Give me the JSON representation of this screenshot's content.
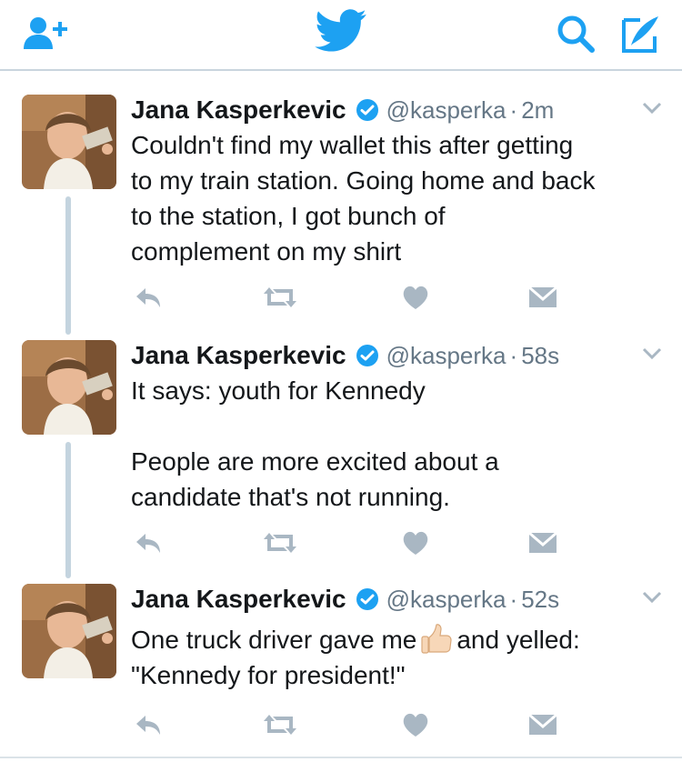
{
  "app": {
    "accent": "#1da1f2",
    "icon_gray": "#a9b7c3"
  },
  "topbar": {
    "icons": [
      "add-user-icon",
      "twitter-bird-icon",
      "search-icon",
      "compose-icon"
    ]
  },
  "tweets": [
    {
      "name": "Jana Kasperkevic",
      "handle": "@kasperka",
      "separator": "·",
      "time": "2m",
      "text": "Couldn't find my wallet this after getting\nto my train station. Going home and back\nto the station, I got bunch of\ncomplement on my shirt"
    },
    {
      "name": "Jana Kasperkevic",
      "handle": "@kasperka",
      "separator": "·",
      "time": "58s",
      "text": "It says: youth for Kennedy\n\nPeople are more excited about a\ncandidate that's not running."
    },
    {
      "name": "Jana Kasperkevic",
      "handle": "@kasperka",
      "separator": "·",
      "time": "52s",
      "text_before_emoji": "One truck driver gave me",
      "emoji": "thumbs-up",
      "text_after_emoji": "and yelled:\n\"Kennedy for president!\""
    }
  ]
}
